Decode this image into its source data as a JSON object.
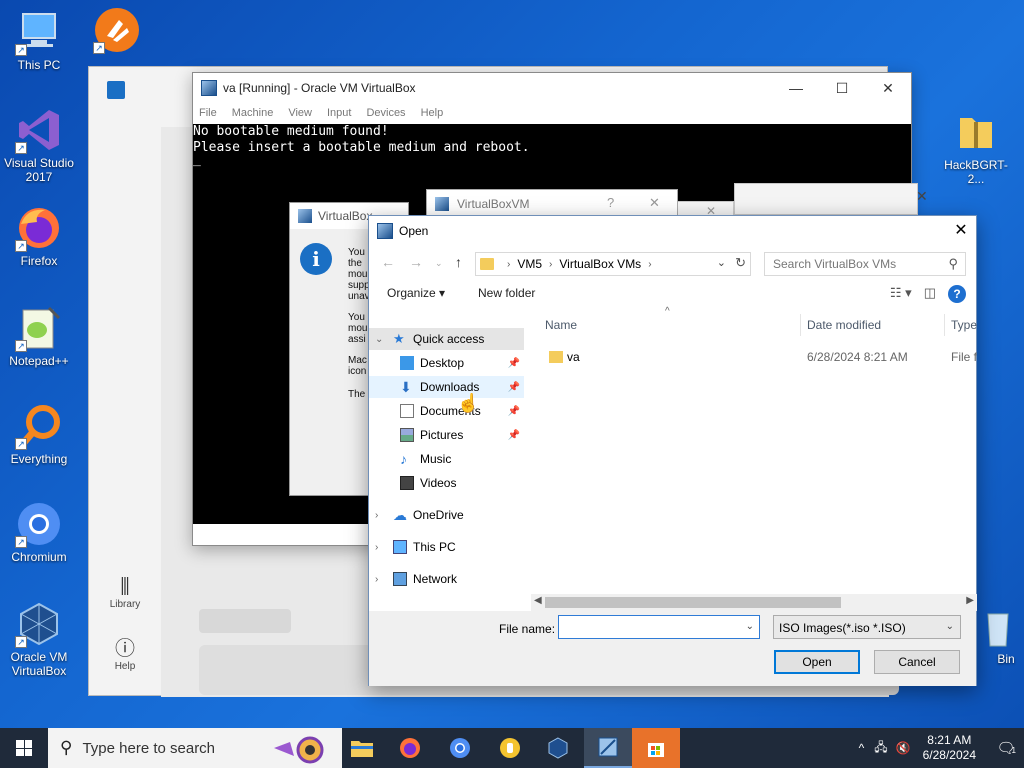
{
  "desktop": {
    "icons": [
      {
        "label": "This PC"
      },
      {
        "label": "Visual Studio 2017"
      },
      {
        "label": "Firefox"
      },
      {
        "label": "Notepad++"
      },
      {
        "label": "Everything"
      },
      {
        "label": "Chromium"
      },
      {
        "label": "Oracle VM VirtualBox"
      },
      {
        "label": "HackBGRT-2..."
      },
      {
        "label": "Bin"
      }
    ]
  },
  "bg_app": {
    "library_label": "Library",
    "help_label": "Help"
  },
  "vm_window": {
    "title": "va [Running] - Oracle VM VirtualBox",
    "menu": [
      "File",
      "Machine",
      "View",
      "Input",
      "Devices",
      "Help"
    ],
    "screen_lines": [
      "No bootable medium found!",
      "Please insert a bootable medium and reboot.",
      "_"
    ]
  },
  "vb_dialog": {
    "title": "VirtualBox",
    "text_fragments": [
      "You",
      "the",
      "mou",
      "supp",
      "unav",
      "You",
      "mou",
      "assi",
      "Mac",
      "icon",
      "The"
    ]
  },
  "vbvm_dialog": {
    "title": "VirtualBoxVM",
    "help_glyph": "?",
    "close_glyph": "✕"
  },
  "open_dialog": {
    "title": "Open",
    "path": [
      "VM5",
      "VirtualBox VMs"
    ],
    "search_placeholder": "Search VirtualBox VMs",
    "organize_label": "Organize ▾",
    "new_folder_label": "New folder",
    "nav": {
      "quick_access": "Quick access",
      "items": [
        "Desktop",
        "Downloads",
        "Documents",
        "Pictures",
        "Music",
        "Videos"
      ],
      "onedrive": "OneDrive",
      "this_pc": "This PC",
      "network": "Network"
    },
    "columns": {
      "name": "Name",
      "date": "Date modified",
      "type": "Type"
    },
    "files": [
      {
        "name": "va",
        "date": "6/28/2024 8:21 AM",
        "type": "File f"
      }
    ],
    "file_name_label": "File name:",
    "file_name_value": "",
    "file_type_value": "ISO Images(*.iso *.ISO)",
    "open_button": "Open",
    "cancel_button": "Cancel"
  },
  "taskbar": {
    "search_placeholder": "Type here to search",
    "time": "8:21 AM",
    "date": "6/28/2024",
    "notification_count": "1"
  },
  "colors": {
    "desktop_bg": "#1466d0",
    "taskbar_bg": "#1f2a3a",
    "selection": "#cce8ff",
    "accent": "#0078d7"
  }
}
